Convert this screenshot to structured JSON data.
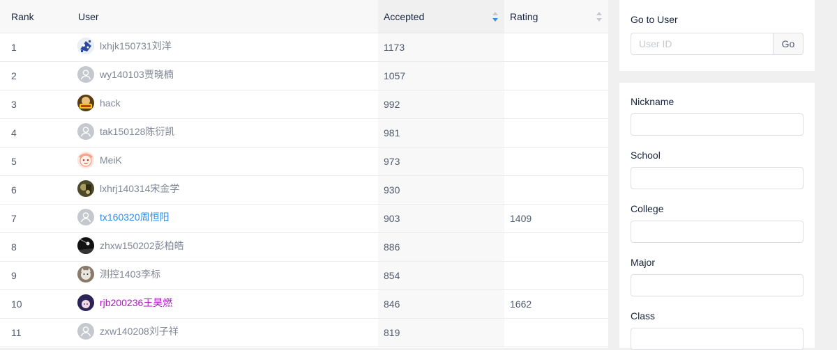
{
  "table": {
    "headers": {
      "rank": "Rank",
      "user": "User",
      "accepted": "Accepted",
      "rating": "Rating"
    },
    "sort": {
      "column": "accepted",
      "direction": "descending"
    },
    "rows": [
      {
        "rank": "1",
        "user": "lxhjk150731刘洋",
        "accepted": "1173",
        "rating": "",
        "avatar": "custom-blue",
        "name_color": "gray"
      },
      {
        "rank": "2",
        "user": "wy140103贾晓楠",
        "accepted": "1057",
        "rating": "",
        "avatar": "default",
        "name_color": "gray"
      },
      {
        "rank": "3",
        "user": "hack",
        "accepted": "992",
        "rating": "",
        "avatar": "custom-yellow",
        "name_color": "gray"
      },
      {
        "rank": "4",
        "user": "tak150128陈衍凯",
        "accepted": "981",
        "rating": "",
        "avatar": "default",
        "name_color": "gray"
      },
      {
        "rank": "5",
        "user": "MeiK",
        "accepted": "973",
        "rating": "",
        "avatar": "custom-pink",
        "name_color": "gray"
      },
      {
        "rank": "6",
        "user": "lxhrj140314宋金学",
        "accepted": "930",
        "rating": "",
        "avatar": "custom-olive",
        "name_color": "gray"
      },
      {
        "rank": "7",
        "user": "tx160320周恒阳",
        "accepted": "903",
        "rating": "1409",
        "avatar": "default",
        "name_color": "blue"
      },
      {
        "rank": "8",
        "user": "zhxw150202彭柏皓",
        "accepted": "886",
        "rating": "",
        "avatar": "custom-dark",
        "name_color": "gray"
      },
      {
        "rank": "9",
        "user": "测控1403李标",
        "accepted": "854",
        "rating": "",
        "avatar": "custom-cat",
        "name_color": "gray"
      },
      {
        "rank": "10",
        "user": "rjb200236王昊燃",
        "accepted": "846",
        "rating": "1662",
        "avatar": "custom-anime",
        "name_color": "purple"
      },
      {
        "rank": "11",
        "user": "zxw140208刘子祥",
        "accepted": "819",
        "rating": "",
        "avatar": "default",
        "name_color": "gray"
      }
    ]
  },
  "goto": {
    "title": "Go to User",
    "placeholder": "User ID",
    "button": "Go"
  },
  "filters": {
    "fields": [
      {
        "label": "Nickname",
        "value": ""
      },
      {
        "label": "School",
        "value": ""
      },
      {
        "label": "College",
        "value": ""
      },
      {
        "label": "Major",
        "value": ""
      },
      {
        "label": "Class",
        "value": ""
      }
    ]
  },
  "colors": {
    "link_blue": "#2d8cf0",
    "rating_purple": "#b312c9",
    "muted_text": "#808695",
    "default_avatar": "#c5c8ce"
  }
}
